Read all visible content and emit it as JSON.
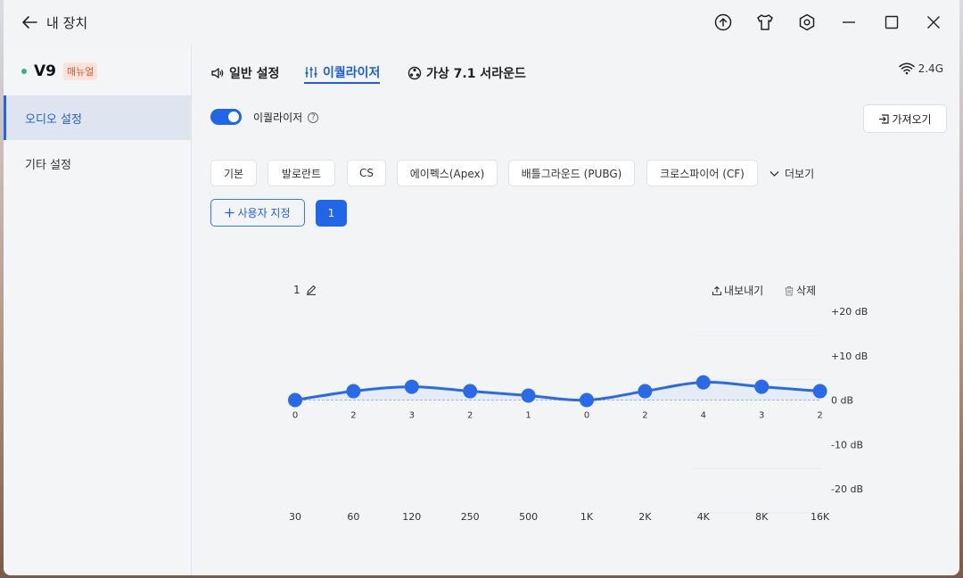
{
  "titlebar": {
    "title": "내 장치",
    "icons": [
      "back-arrow-icon",
      "upload-icon",
      "shirt-icon",
      "settings-hex-icon",
      "minimize-icon",
      "maximize-icon",
      "close-icon"
    ]
  },
  "sidebar": {
    "device_name": "V9",
    "manual_badge": "매뉴얼",
    "items": [
      {
        "label": "오디오 설정",
        "active": true
      },
      {
        "label": "기타 설정",
        "active": false
      }
    ]
  },
  "tabs": [
    {
      "label": "일반 설정",
      "icon": "speaker-icon",
      "active": false
    },
    {
      "label": "이퀄라이저",
      "icon": "equalizer-icon",
      "active": true
    },
    {
      "label": "가상 7.1 서라운드",
      "icon": "surround-icon",
      "active": false
    }
  ],
  "connection": {
    "label": "2.4G",
    "icon": "wifi-icon"
  },
  "equalizer": {
    "label": "이퀄라이저",
    "enabled": true,
    "import_label": "가져오기",
    "presets": [
      "기본",
      "발로란트",
      "CS",
      "에이펙스(Apex)",
      "배틀그라운드 (PUBG)",
      "크로스파이어 (CF)"
    ],
    "more_label": "더보기",
    "custom_label": "사용자 지정",
    "profile_label": "1"
  },
  "chart_header": {
    "name": "1",
    "export_label": "내보내기",
    "delete_label": "삭제"
  },
  "chart_data": {
    "type": "line",
    "x": [
      "30",
      "60",
      "120",
      "250",
      "500",
      "1K",
      "2K",
      "4K",
      "8K",
      "16K"
    ],
    "values": [
      0,
      2,
      3,
      2,
      1,
      0,
      2,
      4,
      3,
      2
    ],
    "y_ticks": [
      "+20 dB",
      "+10 dB",
      "0 dB",
      "-10 dB",
      "-20 dB"
    ],
    "ylim": [
      -20,
      20
    ],
    "color": "#2a6ae8"
  }
}
